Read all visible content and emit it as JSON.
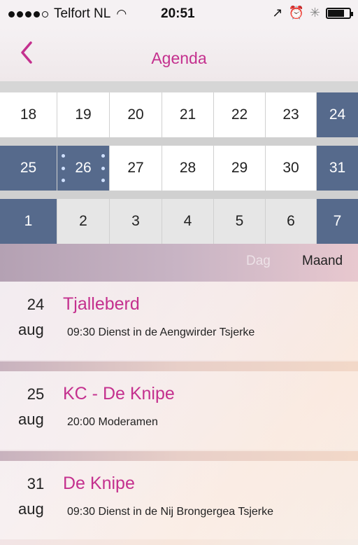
{
  "status_bar": {
    "carrier": "Telfort NL",
    "time": "20:51",
    "battery_level": 0.75
  },
  "nav": {
    "back_icon": "chevron-left-icon",
    "title": "Agenda"
  },
  "calendar": {
    "rows": [
      [
        "18",
        "19",
        "20",
        "21",
        "22",
        "23",
        "24"
      ],
      [
        "25",
        "26",
        "27",
        "28",
        "29",
        "30",
        "31"
      ],
      [
        "1",
        "2",
        "3",
        "4",
        "5",
        "6",
        "7"
      ]
    ],
    "selected": "26",
    "highlight_color": "#566a8c"
  },
  "view_toggle": {
    "day_label": "Dag",
    "month_label": "Maand"
  },
  "events": [
    {
      "day": "24",
      "month": "aug",
      "title": "Tjalleberd",
      "time": "09:30",
      "description": "Dienst in de Aengwirder Tsjerke"
    },
    {
      "day": "25",
      "month": "aug",
      "title": "KC - De Knipe",
      "time": "20:00",
      "description": "Moderamen"
    },
    {
      "day": "31",
      "month": "aug",
      "title": "De Knipe",
      "time": "09:30",
      "description": "Dienst in de Nij Brongergea Tsjerke"
    }
  ],
  "colors": {
    "accent": "#c4308e",
    "calendar_highlight": "#566a8c"
  }
}
